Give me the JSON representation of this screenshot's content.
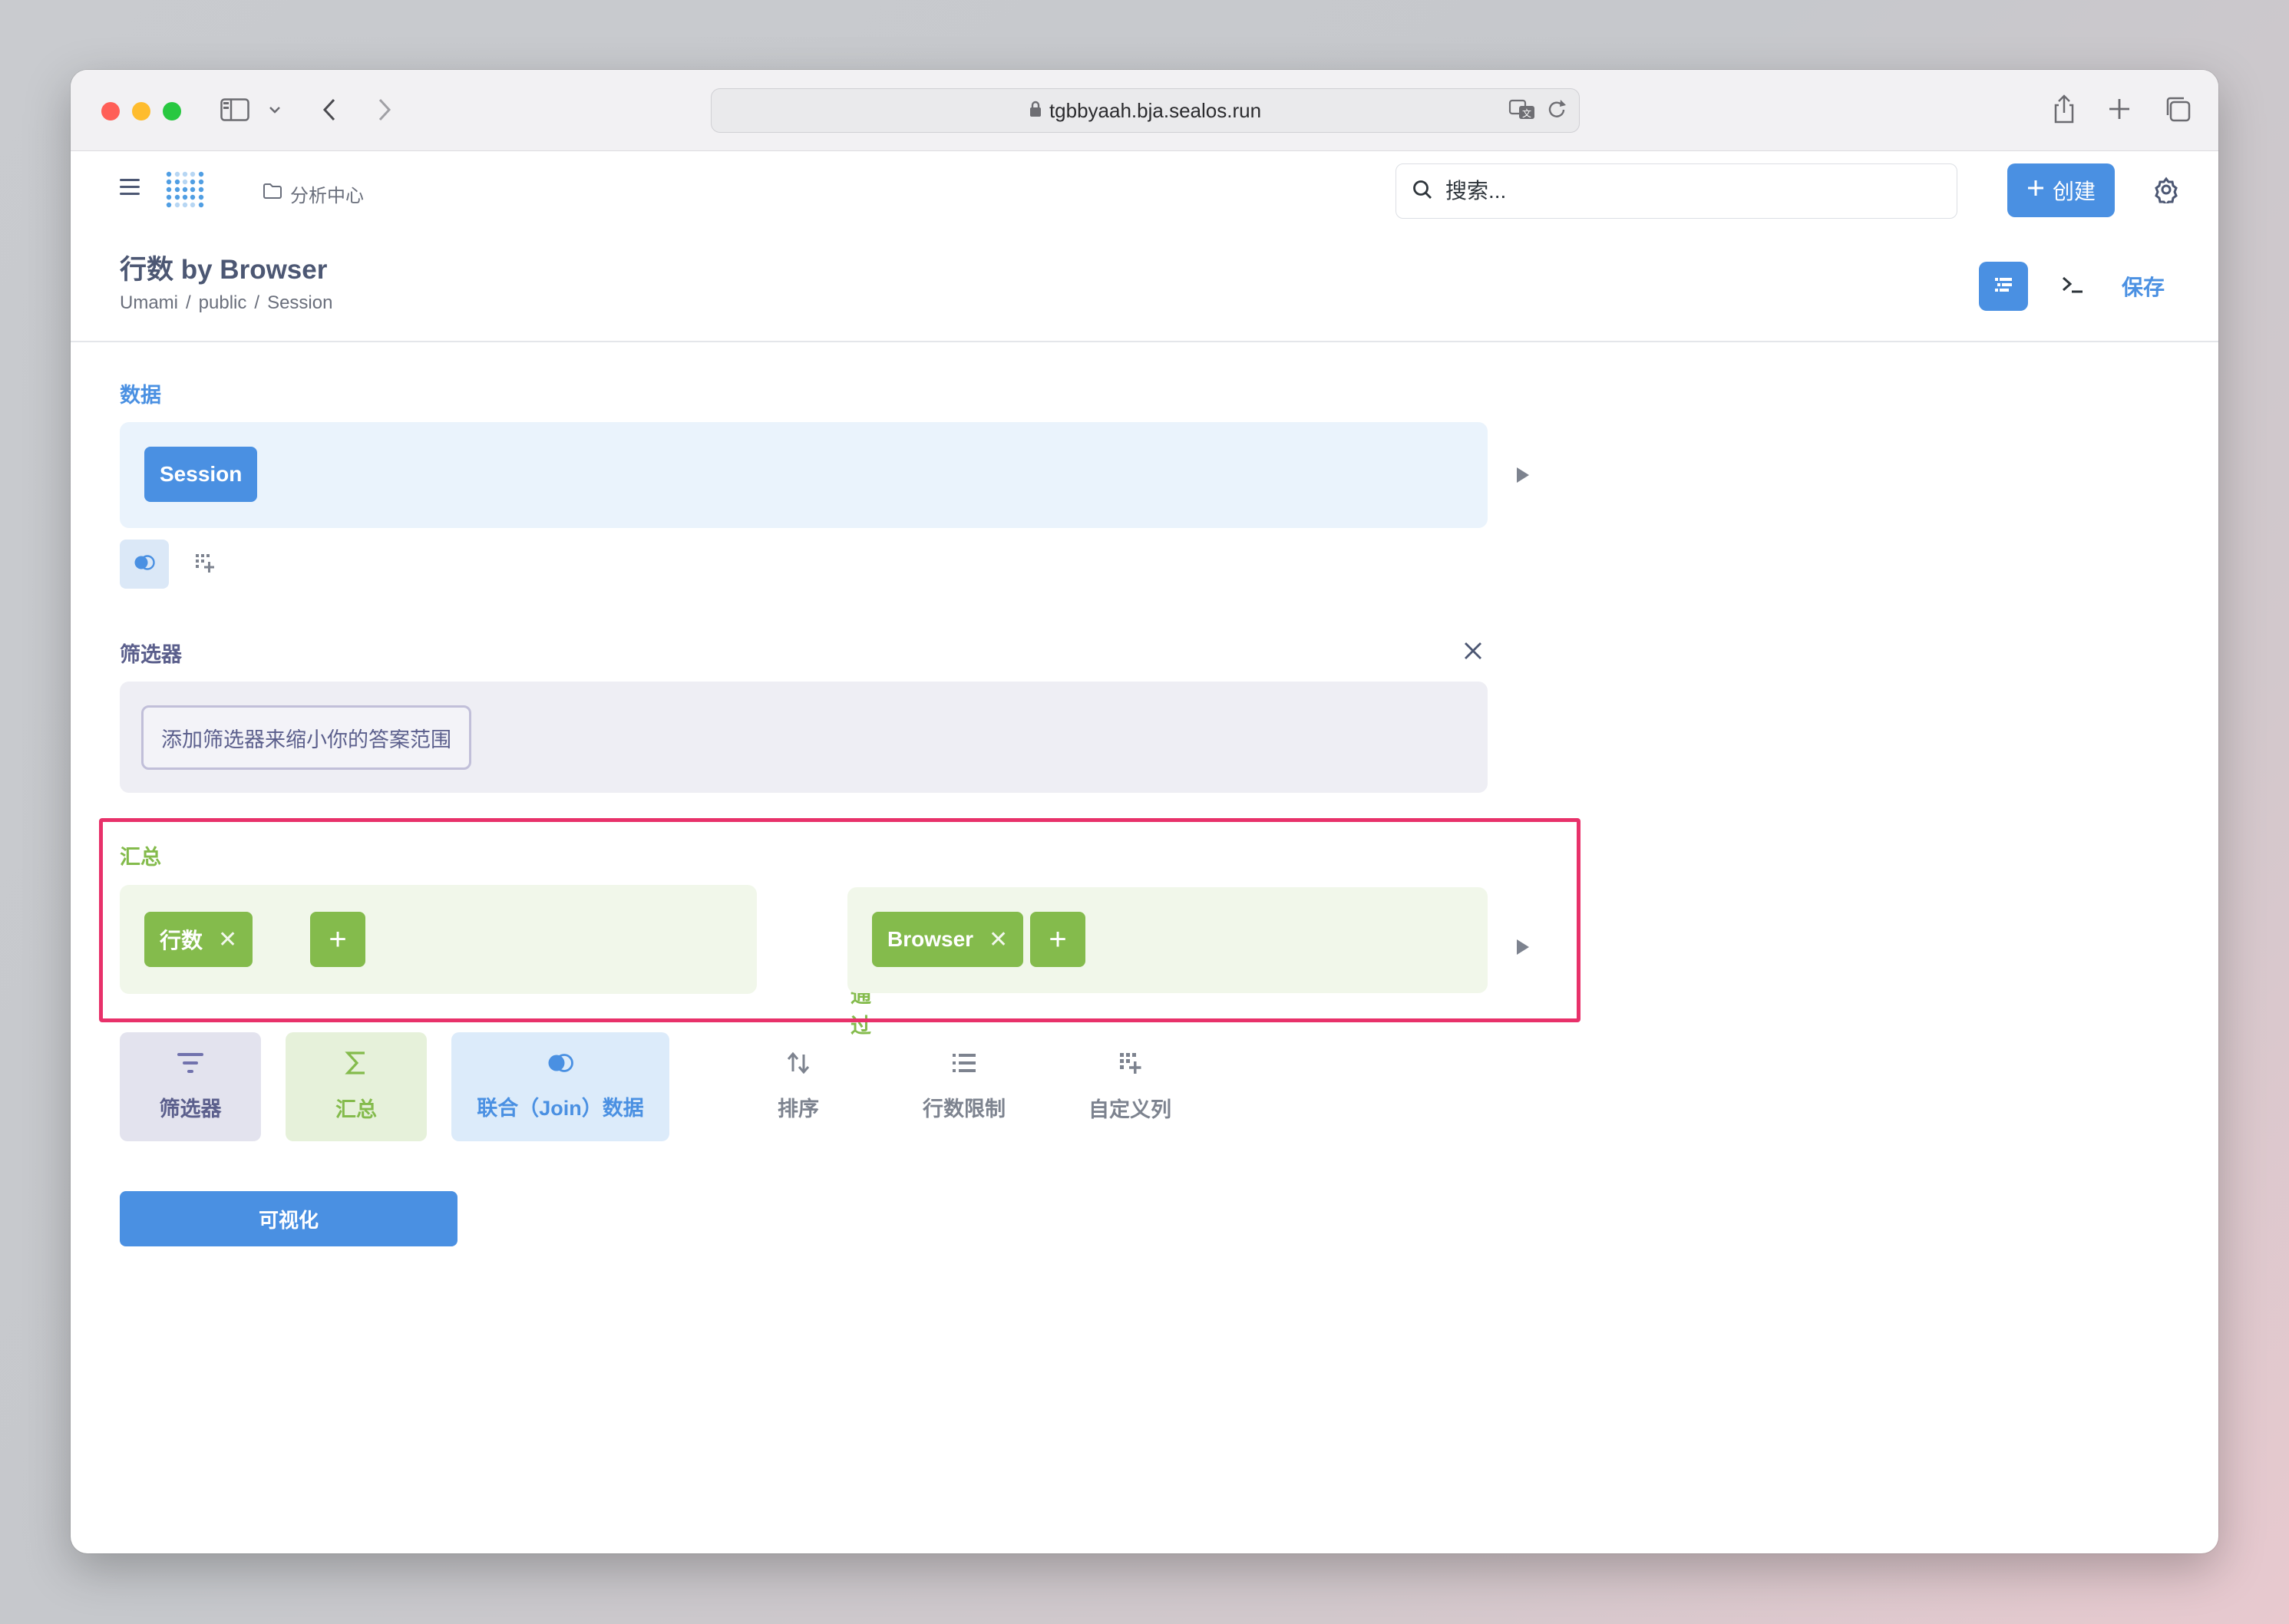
{
  "browser": {
    "url": "tgbbyaah.bja.sealos.run"
  },
  "header": {
    "collection": "分析中心",
    "search_placeholder": "搜索...",
    "create_label": "创建"
  },
  "question": {
    "title": "行数 by Browser",
    "breadcrumb": [
      "Umami",
      "public",
      "Session"
    ],
    "save_label": "保存"
  },
  "notebook": {
    "data": {
      "label": "数据",
      "table": "Session"
    },
    "filter": {
      "label": "筛选器",
      "hint": "添加筛选器来缩小你的答案范围"
    },
    "summarize": {
      "label": "汇总",
      "metric": "行数",
      "by_label_1": "通",
      "by_label_2": "过",
      "breakout": "Browser"
    },
    "actions": [
      {
        "label": "筛选器"
      },
      {
        "label": "汇总"
      },
      {
        "label": "联合（Join）数据"
      },
      {
        "label": "排序"
      },
      {
        "label": "行数限制"
      },
      {
        "label": "自定义列"
      }
    ],
    "visualize_label": "可视化"
  },
  "colors": {
    "brand": "#4a90e2",
    "filter": "#7172ad",
    "summarize": "#84bb4c",
    "highlight": "#e8316a"
  }
}
